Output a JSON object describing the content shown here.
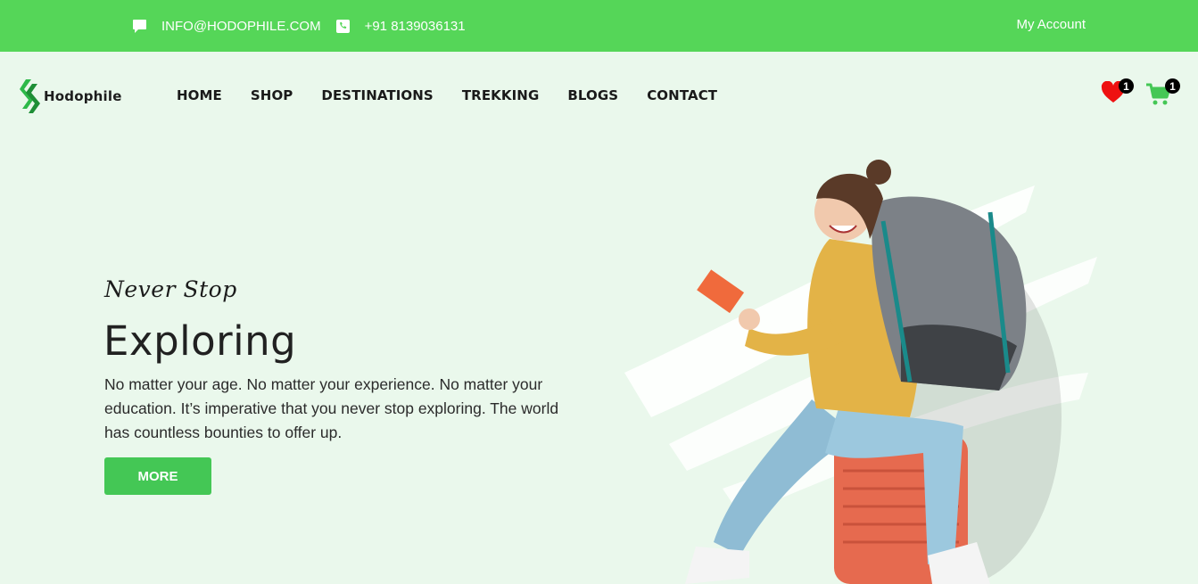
{
  "topbar": {
    "email": "INFO@HODOPHILE.COM",
    "phone": "+91 8139036131",
    "account": "My Account",
    "email_icon": "chat-icon",
    "phone_icon": "phone-icon"
  },
  "header": {
    "logo_text": "Hodophile",
    "nav": [
      "HOME",
      "SHOP",
      "DESTINATIONS",
      "TREKKING",
      "BLOGS",
      "CONTACT"
    ],
    "wishlist_count": "1",
    "cart_count": "1"
  },
  "hero": {
    "tagline": "Never Stop",
    "title": "Exploring",
    "description": "No matter your age. No matter your experience. No matter your education. It’s imperative that you never stop exploring. The world has countless bounties to offer up.",
    "button": "MORE"
  },
  "colors": {
    "topbar": "#55d658",
    "background": "#eaf8ec",
    "accent": "#44c755",
    "heart": "#ee1111"
  }
}
